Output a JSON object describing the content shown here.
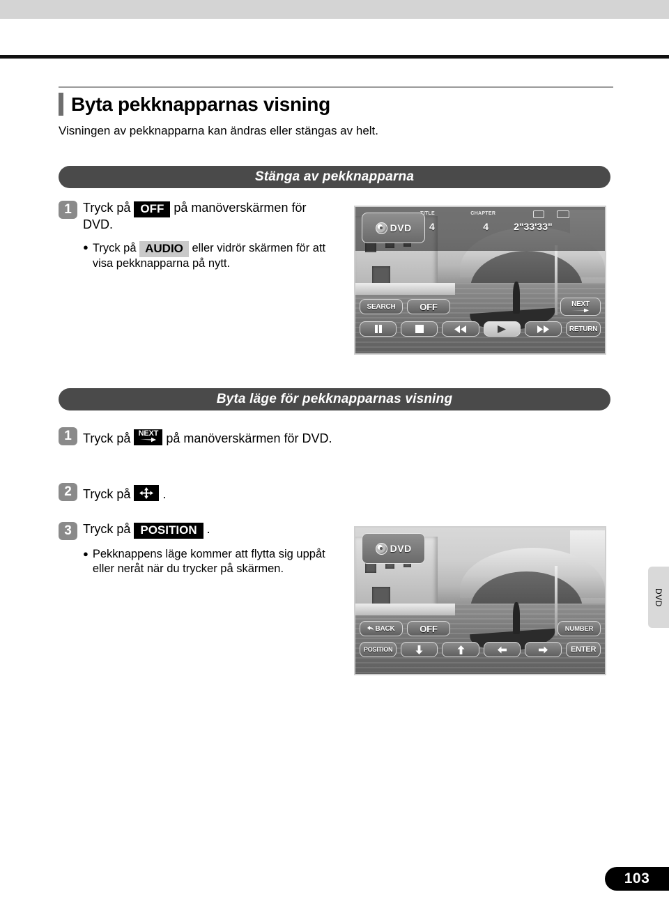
{
  "page": {
    "number": "103",
    "side_tab_label": "DVD"
  },
  "header": {
    "title": "Byta pekknapparnas visning",
    "subtitle": "Visningen av pekknapparna kan ändras eller stängas av helt."
  },
  "sections": [
    {
      "banner": "Stänga av pekknapparna",
      "steps": [
        {
          "num": "1",
          "text_before": "Tryck på",
          "key": "OFF",
          "key_style": "dark",
          "text_after": "på manöverskärmen för DVD.",
          "bullet": {
            "text_before": "Tryck på",
            "key": "AUDIO",
            "key_style": "light",
            "text_after": "eller vidrör skärmen för att visa pekknapparna på nytt."
          }
        }
      ]
    },
    {
      "banner": "Byta läge för pekknapparnas visning",
      "steps": [
        {
          "num": "1",
          "text_before": "Tryck på",
          "key": "NEXT",
          "key_style": "next-icon",
          "text_after": "på manöverskärmen för DVD."
        },
        {
          "num": "2",
          "text_before": "Tryck på",
          "key": "pad-icon",
          "key_style": "pad-icon",
          "text_after": "."
        },
        {
          "num": "3",
          "text_before": "Tryck på",
          "key": "POSITION",
          "key_style": "dark",
          "text_after": ".",
          "bullet": {
            "text_before": "",
            "key": "",
            "key_style": "",
            "text_after": "Pekknappens läge kommer att flytta sig uppåt eller neråt när du trycker på skärmen."
          }
        }
      ]
    }
  ],
  "screen_one": {
    "source_label": "DVD",
    "status": {
      "title_label": "TITLE",
      "title_value": "4",
      "chapter_label": "CHAPTER",
      "chapter_value": "4",
      "time_value": "2\"33'33\""
    },
    "buttons_top": [
      "SEARCH",
      "OFF",
      "NEXT"
    ],
    "buttons_bottom": [
      "pause",
      "stop",
      "rewind",
      "play",
      "fast-forward",
      "RETURN"
    ],
    "button_labels_bottom": [
      "",
      "",
      "",
      "",
      "",
      "RETURN"
    ]
  },
  "screen_two": {
    "source_label": "DVD",
    "buttons_top": [
      "BACK",
      "OFF",
      "NUMBER"
    ],
    "buttons_bottom": [
      "POSITION",
      "down",
      "up",
      "left",
      "right",
      "ENTER"
    ]
  },
  "colors": {
    "banner_bg": "#4a4a4a",
    "step_badge_bg": "#8a8a8a",
    "key_dark_bg": "#000000",
    "key_light_bg": "#c9c9c9",
    "page_num_bg": "#000000"
  }
}
